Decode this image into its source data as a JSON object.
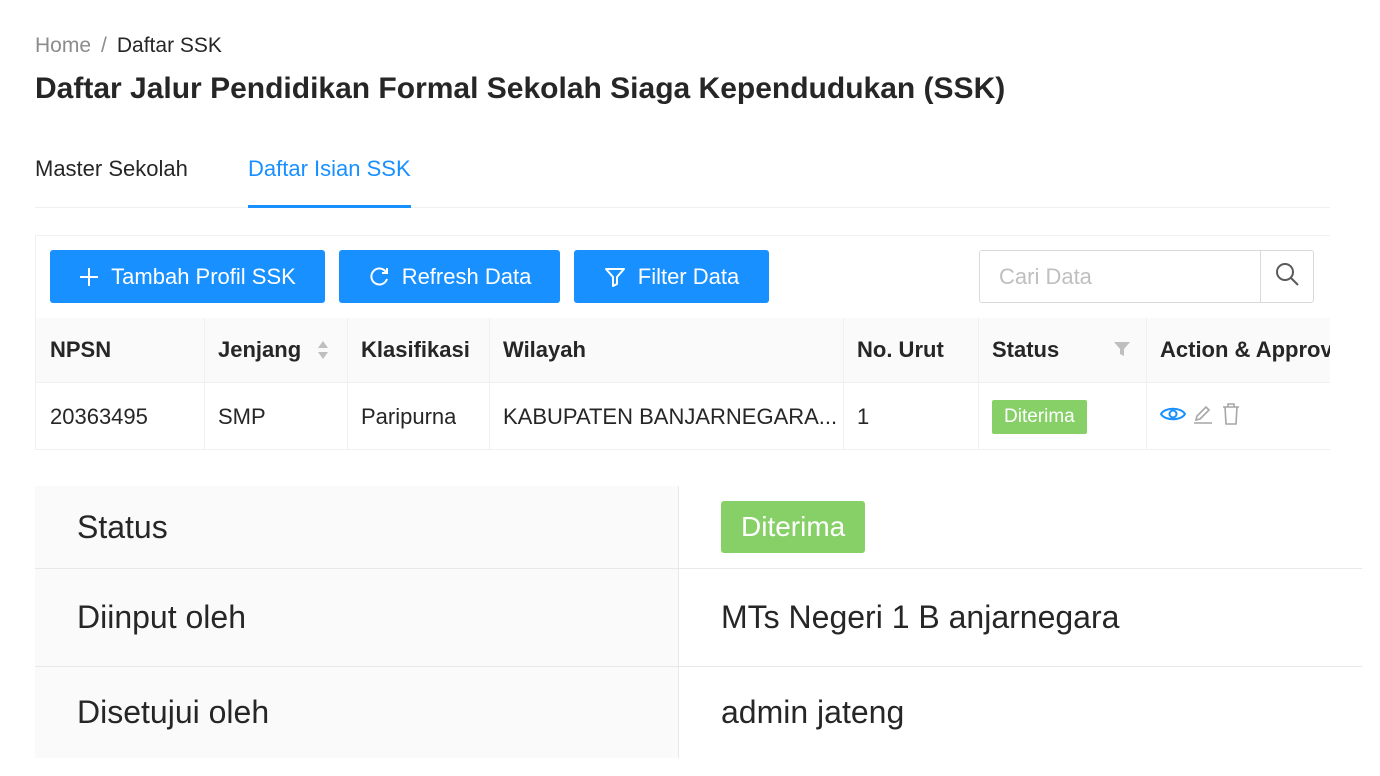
{
  "breadcrumb": {
    "home": "Home",
    "separator": "/",
    "current": "Daftar SSK"
  },
  "page_title": "Daftar Jalur Pendidikan Formal Sekolah Siaga Kependudukan (SSK)",
  "tabs": [
    {
      "label": "Master Sekolah",
      "active": false
    },
    {
      "label": "Daftar Isian SSK",
      "active": true
    }
  ],
  "toolbar": {
    "add_label": "Tambah Profil SSK",
    "refresh_label": "Refresh Data",
    "filter_label": "Filter Data",
    "search_placeholder": "Cari Data",
    "button_color": "#1890ff"
  },
  "table": {
    "columns": [
      "NPSN",
      "Jenjang",
      "Klasifikasi",
      "Wilayah",
      "No. Urut",
      "Status",
      "Action & Approval"
    ],
    "rows": [
      {
        "npsn": "20363495",
        "jenjang": "SMP",
        "klasifikasi": "Paripurna",
        "wilayah": "KABUPATEN BANJARNEGARA...",
        "no_urut": "1",
        "status": "Diterima"
      }
    ]
  },
  "detail": {
    "status_label": "Status",
    "status_value": "Diterima",
    "input_label": "Diinput oleh",
    "input_value": "MTs Negeri 1 B anjarnegara",
    "approved_label": "Disetujui oleh",
    "approved_value": "admin jateng"
  },
  "colors": {
    "accent": "#1890ff",
    "success": "#87d068"
  },
  "icons": [
    "plus-icon",
    "refresh-icon",
    "filter-icon",
    "search-icon",
    "sort-icon",
    "column-filter-icon",
    "view-icon",
    "edit-icon",
    "delete-icon"
  ]
}
